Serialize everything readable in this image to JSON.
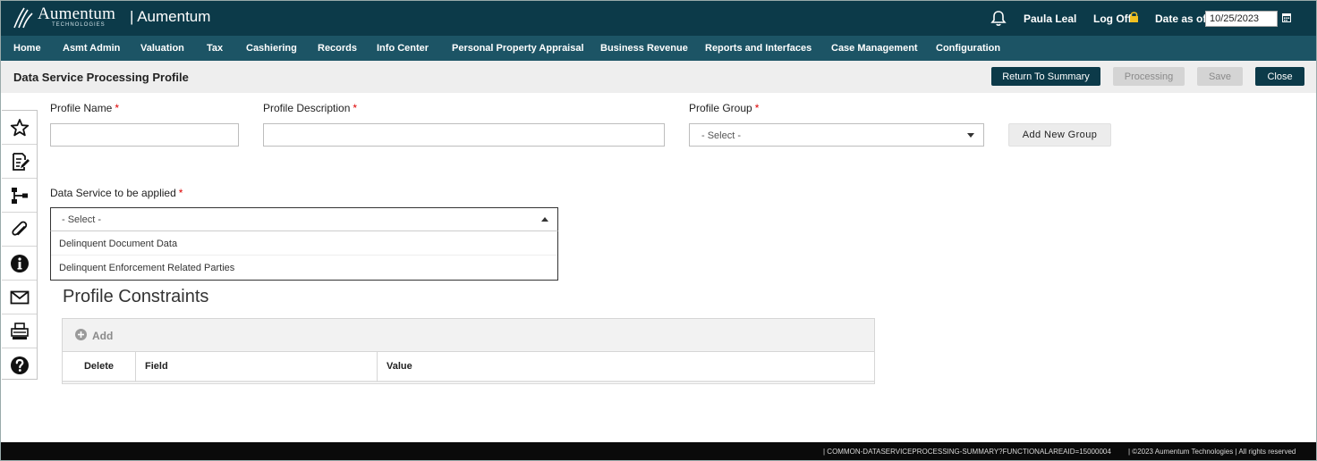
{
  "header": {
    "logo_text": "Aumentum",
    "logo_subtext": "TECHNOLOGIES",
    "app_title": "| Aumentum",
    "user_name": "Paula Leal",
    "logoff_label": "Log Off",
    "date_label": "Date as of:",
    "date_value": "10/25/2023",
    "icons": {
      "notifications": "bell-icon",
      "lock": "lock-icon",
      "calendar": "calendar-icon"
    },
    "colors": {
      "header_bg": "#0c3a49",
      "menu_bg": "#1c5465",
      "accent_lock": "#f0c020"
    }
  },
  "menu": {
    "items": [
      {
        "label": "Home"
      },
      {
        "label": "Asmt Admin"
      },
      {
        "label": "Valuation"
      },
      {
        "label": "Tax"
      },
      {
        "label": "Cashiering"
      },
      {
        "label": "Records"
      },
      {
        "label": "Info Center"
      },
      {
        "label": "Personal Property Appraisal"
      },
      {
        "label": "Business Revenue"
      },
      {
        "label": "Reports and Interfaces"
      },
      {
        "label": "Case Management"
      },
      {
        "label": "Configuration"
      }
    ]
  },
  "titlebar": {
    "title": "Data Service Processing Profile",
    "buttons": {
      "return_to_summary": "Return To Summary",
      "processing": "Processing",
      "save": "Save",
      "close": "Close"
    }
  },
  "sidebar": {
    "tools": [
      {
        "icon": "star-icon"
      },
      {
        "icon": "notes-edit-icon"
      },
      {
        "icon": "hierarchy-icon"
      },
      {
        "icon": "paperclip-icon"
      },
      {
        "icon": "info-icon"
      },
      {
        "icon": "mail-icon"
      },
      {
        "icon": "print-icon"
      },
      {
        "icon": "help-icon"
      }
    ]
  },
  "form": {
    "profile_name": {
      "label": "Profile Name",
      "required_mark": "*",
      "value": ""
    },
    "profile_description": {
      "label": "Profile Description",
      "required_mark": "*",
      "value": ""
    },
    "profile_group": {
      "label": "Profile Group",
      "required_mark": "*",
      "selected": "- Select -"
    },
    "add_new_group_label": "Add New Group",
    "data_service": {
      "label": "Data Service to be applied",
      "required_mark": "*",
      "selected": "- Select -",
      "options": [
        "Delinquent Document Data",
        "Delinquent Enforcement Related Parties"
      ]
    }
  },
  "constraints": {
    "title": "Profile Constraints",
    "add_label": "Add",
    "columns": [
      "Delete",
      "Field",
      "Value"
    ]
  },
  "footer": {
    "path": "|   COMMON-DATASERVICEPROCESSING-SUMMARY?FUNCTIONALAREAID=15000004",
    "copyright": "|   ©2023 Aumentum Technologies | All rights reserved"
  }
}
